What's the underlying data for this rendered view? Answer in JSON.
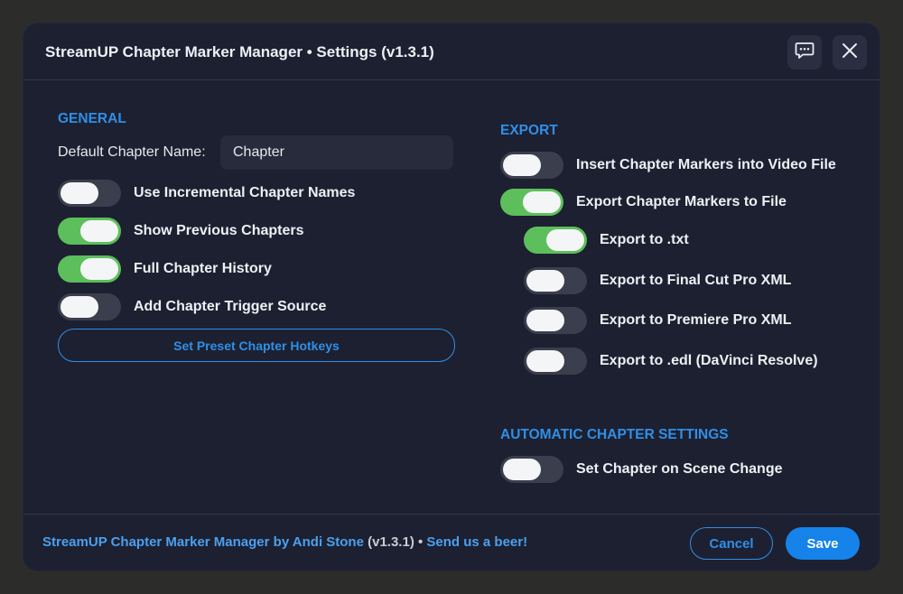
{
  "window": {
    "title": "StreamUP Chapter Marker Manager • Settings (v1.3.1)"
  },
  "general": {
    "heading": "GENERAL",
    "default_name_label": "Default Chapter Name:",
    "default_name_value": "Chapter",
    "toggles": [
      {
        "label": "Use Incremental Chapter Names",
        "on": false
      },
      {
        "label": "Show Previous Chapters",
        "on": true
      },
      {
        "label": "Full Chapter History",
        "on": true
      },
      {
        "label": "Add Chapter Trigger Source",
        "on": false
      }
    ],
    "hotkeys_button": "Set Preset Chapter Hotkeys"
  },
  "export": {
    "heading": "EXPORT",
    "toggles": [
      {
        "label": "Insert Chapter Markers into Video File",
        "on": false
      },
      {
        "label": "Export Chapter Markers to File",
        "on": true
      },
      {
        "label": "Export to .txt",
        "on": true
      },
      {
        "label": "Export to Final Cut Pro XML",
        "on": false
      },
      {
        "label": "Export to Premiere Pro XML",
        "on": false
      },
      {
        "label": "Export to .edl (DaVinci Resolve)",
        "on": false
      }
    ]
  },
  "automatic": {
    "heading": "AUTOMATIC CHAPTER SETTINGS",
    "toggles": [
      {
        "label": "Set Chapter on Scene Change",
        "on": false
      }
    ]
  },
  "footer": {
    "prefix": "StreamUP Chapter Marker Manager by ",
    "author": "Andi Stone",
    "version": " (v1.3.1) • ",
    "beer_link": "Send us a beer!",
    "cancel_label": "Cancel",
    "save_label": "Save"
  },
  "colors": {
    "accent": "#2f8fe8",
    "toggle_on": "#5cbf5b",
    "toggle_off": "#3a3e4d",
    "background": "#1d2030"
  },
  "icons": {
    "feedback": "chat-bubble-icon",
    "close": "close-icon"
  }
}
